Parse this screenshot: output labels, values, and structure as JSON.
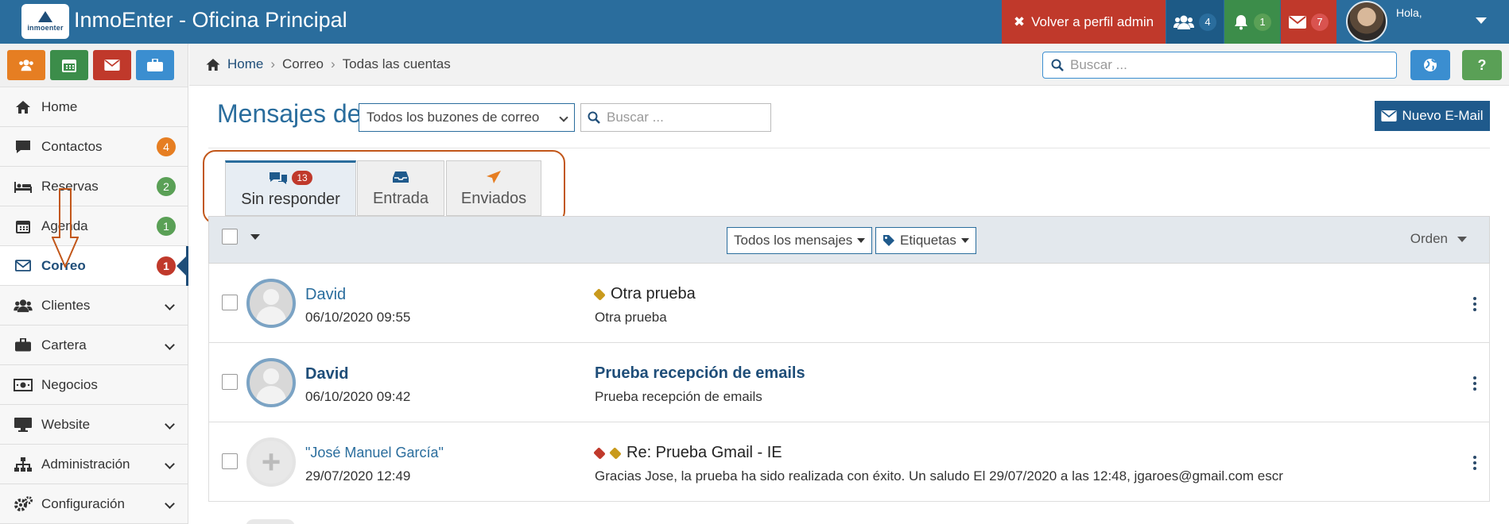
{
  "app": {
    "logo_text": "inmoenter",
    "title": "InmoEnter - Oficina Principal"
  },
  "topbar": {
    "admin_button": "Volver a perfil admin",
    "notif_users": "4",
    "notif_bell": "1",
    "notif_mail": "7",
    "greeting": "Hola,"
  },
  "sidebar": {
    "items": [
      {
        "label": "Home",
        "icon": "home-icon"
      },
      {
        "label": "Contactos",
        "icon": "comment-icon",
        "badge": "4"
      },
      {
        "label": "Reservas",
        "icon": "bed-icon",
        "badge": "2"
      },
      {
        "label": "Agenda",
        "icon": "calendar-icon",
        "badge": "1"
      },
      {
        "label": "Correo",
        "icon": "envelope-icon",
        "badge": "1"
      },
      {
        "label": "Clientes",
        "icon": "users-icon"
      },
      {
        "label": "Cartera",
        "icon": "briefcase-icon"
      },
      {
        "label": "Negocios",
        "icon": "money-icon"
      },
      {
        "label": "Website",
        "icon": "monitor-icon"
      },
      {
        "label": "Administración",
        "icon": "sitemap-icon"
      },
      {
        "label": "Configuración",
        "icon": "cogs-icon"
      }
    ]
  },
  "breadcrumb": {
    "home": "Home",
    "section": "Correo",
    "current": "Todas las cuentas"
  },
  "top_search": {
    "placeholder": "Buscar ..."
  },
  "help_label": "?",
  "main": {
    "title": "Mensajes de",
    "mailbox_selected": "Todos los buzones de correo",
    "search_placeholder": "Buscar ...",
    "new_email": "Nuevo E-Mail"
  },
  "tabs": [
    {
      "label": "Sin responder",
      "count": "13",
      "active": true
    },
    {
      "label": "Entrada"
    },
    {
      "label": "Enviados"
    }
  ],
  "toolbar": {
    "filter_all": "Todos los mensajes",
    "filter_tags": "Etiquetas",
    "order": "Orden"
  },
  "messages": [
    {
      "from": "David",
      "date": "06/10/2020 09:55",
      "subject": "Otra prueba",
      "preview": "Otra prueba",
      "unread": false
    },
    {
      "from": "David",
      "date": "06/10/2020 09:42",
      "subject": "Prueba recepción de emails",
      "preview": "Prueba recepción de emails",
      "unread": true
    },
    {
      "from": "\"José Manuel García\"",
      "date": "29/07/2020 12:49",
      "subject": "Re: Prueba Gmail - IE",
      "preview": "Gracias Jose, la prueba ha sido realizada con éxito. Un saludo El 29/07/2020 a las 12:48, jgaroes@gmail.com escr",
      "unread": false
    }
  ],
  "colors": {
    "brand": "#2a6d9d",
    "admin_red": "#c0392b",
    "annotation": "#c2571a"
  }
}
